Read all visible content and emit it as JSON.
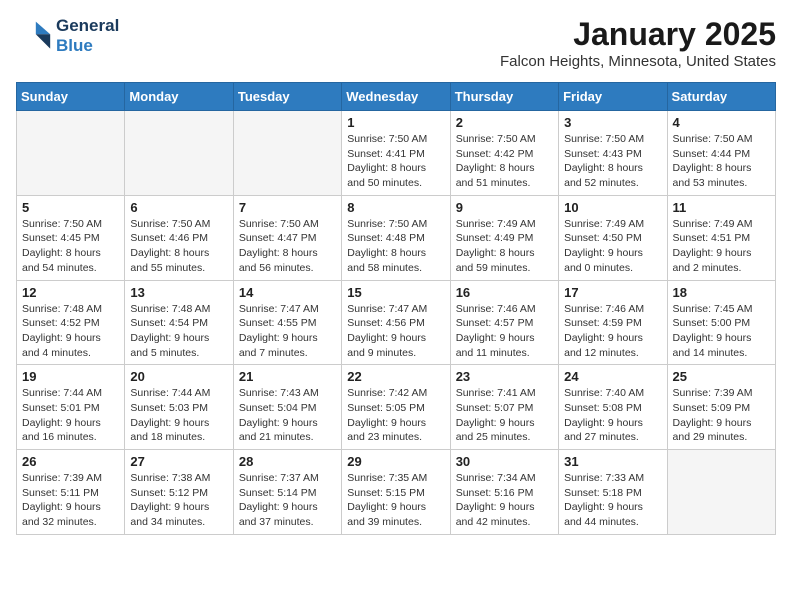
{
  "header": {
    "logo_line1": "General",
    "logo_line2": "Blue",
    "month": "January 2025",
    "location": "Falcon Heights, Minnesota, United States"
  },
  "weekdays": [
    "Sunday",
    "Monday",
    "Tuesday",
    "Wednesday",
    "Thursday",
    "Friday",
    "Saturday"
  ],
  "weeks": [
    [
      {
        "day": "",
        "info": ""
      },
      {
        "day": "",
        "info": ""
      },
      {
        "day": "",
        "info": ""
      },
      {
        "day": "1",
        "info": "Sunrise: 7:50 AM\nSunset: 4:41 PM\nDaylight: 8 hours\nand 50 minutes."
      },
      {
        "day": "2",
        "info": "Sunrise: 7:50 AM\nSunset: 4:42 PM\nDaylight: 8 hours\nand 51 minutes."
      },
      {
        "day": "3",
        "info": "Sunrise: 7:50 AM\nSunset: 4:43 PM\nDaylight: 8 hours\nand 52 minutes."
      },
      {
        "day": "4",
        "info": "Sunrise: 7:50 AM\nSunset: 4:44 PM\nDaylight: 8 hours\nand 53 minutes."
      }
    ],
    [
      {
        "day": "5",
        "info": "Sunrise: 7:50 AM\nSunset: 4:45 PM\nDaylight: 8 hours\nand 54 minutes."
      },
      {
        "day": "6",
        "info": "Sunrise: 7:50 AM\nSunset: 4:46 PM\nDaylight: 8 hours\nand 55 minutes."
      },
      {
        "day": "7",
        "info": "Sunrise: 7:50 AM\nSunset: 4:47 PM\nDaylight: 8 hours\nand 56 minutes."
      },
      {
        "day": "8",
        "info": "Sunrise: 7:50 AM\nSunset: 4:48 PM\nDaylight: 8 hours\nand 58 minutes."
      },
      {
        "day": "9",
        "info": "Sunrise: 7:49 AM\nSunset: 4:49 PM\nDaylight: 8 hours\nand 59 minutes."
      },
      {
        "day": "10",
        "info": "Sunrise: 7:49 AM\nSunset: 4:50 PM\nDaylight: 9 hours\nand 0 minutes."
      },
      {
        "day": "11",
        "info": "Sunrise: 7:49 AM\nSunset: 4:51 PM\nDaylight: 9 hours\nand 2 minutes."
      }
    ],
    [
      {
        "day": "12",
        "info": "Sunrise: 7:48 AM\nSunset: 4:52 PM\nDaylight: 9 hours\nand 4 minutes."
      },
      {
        "day": "13",
        "info": "Sunrise: 7:48 AM\nSunset: 4:54 PM\nDaylight: 9 hours\nand 5 minutes."
      },
      {
        "day": "14",
        "info": "Sunrise: 7:47 AM\nSunset: 4:55 PM\nDaylight: 9 hours\nand 7 minutes."
      },
      {
        "day": "15",
        "info": "Sunrise: 7:47 AM\nSunset: 4:56 PM\nDaylight: 9 hours\nand 9 minutes."
      },
      {
        "day": "16",
        "info": "Sunrise: 7:46 AM\nSunset: 4:57 PM\nDaylight: 9 hours\nand 11 minutes."
      },
      {
        "day": "17",
        "info": "Sunrise: 7:46 AM\nSunset: 4:59 PM\nDaylight: 9 hours\nand 12 minutes."
      },
      {
        "day": "18",
        "info": "Sunrise: 7:45 AM\nSunset: 5:00 PM\nDaylight: 9 hours\nand 14 minutes."
      }
    ],
    [
      {
        "day": "19",
        "info": "Sunrise: 7:44 AM\nSunset: 5:01 PM\nDaylight: 9 hours\nand 16 minutes."
      },
      {
        "day": "20",
        "info": "Sunrise: 7:44 AM\nSunset: 5:03 PM\nDaylight: 9 hours\nand 18 minutes."
      },
      {
        "day": "21",
        "info": "Sunrise: 7:43 AM\nSunset: 5:04 PM\nDaylight: 9 hours\nand 21 minutes."
      },
      {
        "day": "22",
        "info": "Sunrise: 7:42 AM\nSunset: 5:05 PM\nDaylight: 9 hours\nand 23 minutes."
      },
      {
        "day": "23",
        "info": "Sunrise: 7:41 AM\nSunset: 5:07 PM\nDaylight: 9 hours\nand 25 minutes."
      },
      {
        "day": "24",
        "info": "Sunrise: 7:40 AM\nSunset: 5:08 PM\nDaylight: 9 hours\nand 27 minutes."
      },
      {
        "day": "25",
        "info": "Sunrise: 7:39 AM\nSunset: 5:09 PM\nDaylight: 9 hours\nand 29 minutes."
      }
    ],
    [
      {
        "day": "26",
        "info": "Sunrise: 7:39 AM\nSunset: 5:11 PM\nDaylight: 9 hours\nand 32 minutes."
      },
      {
        "day": "27",
        "info": "Sunrise: 7:38 AM\nSunset: 5:12 PM\nDaylight: 9 hours\nand 34 minutes."
      },
      {
        "day": "28",
        "info": "Sunrise: 7:37 AM\nSunset: 5:14 PM\nDaylight: 9 hours\nand 37 minutes."
      },
      {
        "day": "29",
        "info": "Sunrise: 7:35 AM\nSunset: 5:15 PM\nDaylight: 9 hours\nand 39 minutes."
      },
      {
        "day": "30",
        "info": "Sunrise: 7:34 AM\nSunset: 5:16 PM\nDaylight: 9 hours\nand 42 minutes."
      },
      {
        "day": "31",
        "info": "Sunrise: 7:33 AM\nSunset: 5:18 PM\nDaylight: 9 hours\nand 44 minutes."
      },
      {
        "day": "",
        "info": ""
      }
    ]
  ]
}
